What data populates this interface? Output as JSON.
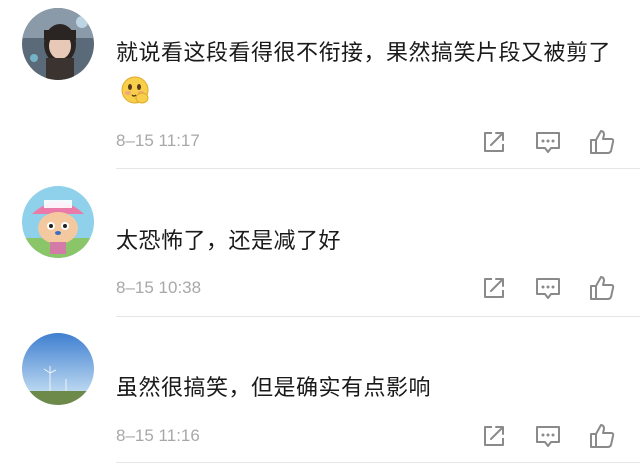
{
  "comments": [
    {
      "text": "就说看这段看得很不衔接，果然搞笑片段又被剪了",
      "emoji": "shy-face-emoji",
      "time": "8–15 11:17",
      "avatar": "girl-photo-avatar"
    },
    {
      "text": "太恐怖了，还是减了好",
      "time": "8–15 10:38",
      "avatar": "chopper-cartoon-avatar"
    },
    {
      "text": "虽然很搞笑，但是确实有点影响",
      "time": "8–15 11:16",
      "avatar": "sky-landscape-avatar"
    }
  ],
  "action_icons": [
    "share-icon",
    "reply-icon",
    "like-icon"
  ],
  "colors": {
    "text": "#1a1a1a",
    "meta": "#a8a8a8",
    "icon": "#8a8a8a",
    "divider": "#e6e6e6"
  }
}
